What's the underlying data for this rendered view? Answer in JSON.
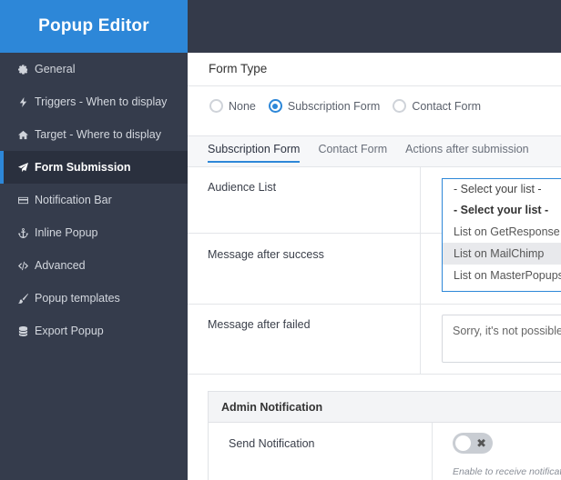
{
  "app": {
    "title": "Popup Editor"
  },
  "sidebar": {
    "items": [
      {
        "label": "General",
        "icon": "gear-icon"
      },
      {
        "label": "Triggers - When to display",
        "icon": "bolt-icon"
      },
      {
        "label": "Target - Where to display",
        "icon": "home-icon"
      },
      {
        "label": "Form Submission",
        "icon": "paper-plane-icon",
        "active": true
      },
      {
        "label": "Notification Bar",
        "icon": "credit-card-icon"
      },
      {
        "label": "Inline Popup",
        "icon": "anchor-icon"
      },
      {
        "label": "Advanced",
        "icon": "code-icon"
      },
      {
        "label": "Popup templates",
        "icon": "brush-icon"
      },
      {
        "label": "Export Popup",
        "icon": "database-icon"
      }
    ]
  },
  "form_type": {
    "title": "Form Type",
    "options": [
      {
        "label": "None",
        "selected": false
      },
      {
        "label": "Subscription Form",
        "selected": true
      },
      {
        "label": "Contact Form",
        "selected": false
      }
    ]
  },
  "tabs": [
    {
      "label": "Subscription Form",
      "active": true
    },
    {
      "label": "Contact Form",
      "active": false
    },
    {
      "label": "Actions after submission",
      "active": false
    }
  ],
  "fields": {
    "audience_list": {
      "label": "Audience List",
      "selected": "- Select your list -",
      "options": [
        "- Select your list -",
        "List on GetResponse",
        "List on MailChimp",
        "List on MasterPopups"
      ],
      "highlighted": "List on MailChimp"
    },
    "message_success": {
      "label": "Message after success"
    },
    "message_failed": {
      "label": "Message after failed",
      "value": "Sorry, it's not possible"
    }
  },
  "admin_notification": {
    "title": "Admin Notification",
    "send_label": "Send Notification",
    "toggle_on": false,
    "toggle_off_symbol": "✖",
    "hint": "Enable to receive notificat"
  },
  "colors": {
    "accent": "#2d87d8",
    "sidebar_bg": "#353c4c",
    "topbar_bg": "#343a4a"
  }
}
